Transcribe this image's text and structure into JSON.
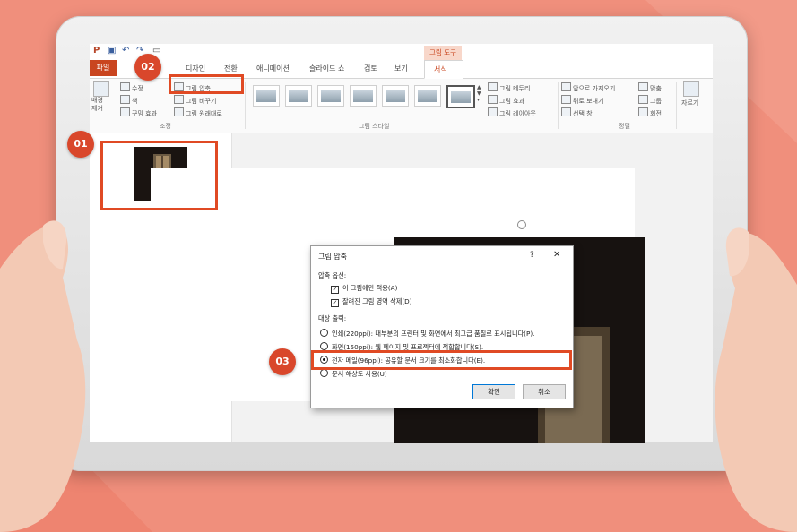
{
  "qat": {
    "icons": [
      "powerpoint-logo-icon",
      "save-icon",
      "undo-icon",
      "redo-icon",
      "presenter-icon"
    ]
  },
  "context_tab": {
    "header": "그림 도구"
  },
  "tabs": [
    {
      "label": "파일"
    },
    {
      "label": "디자인"
    },
    {
      "label": "전환"
    },
    {
      "label": "애니메이션"
    },
    {
      "label": "슬라이드 쇼"
    },
    {
      "label": "검토"
    },
    {
      "label": "보기"
    },
    {
      "label": "서식"
    }
  ],
  "ribbon": {
    "remove_bg": "배경\n제거",
    "corrections": "수정",
    "color": "색",
    "artistic": "꾸밈 효과",
    "compress": "그림 압축",
    "change": "그림 바꾸기",
    "reset": "그림 원래대로",
    "adjust_group": "조정",
    "styles_group": "그림 스타일",
    "border": "그림 테두리",
    "effects": "그림 효과",
    "layout": "그림 레이아웃",
    "bring_forward": "앞으로 가져오기",
    "send_backward": "뒤로 보내기",
    "selection_pane": "선택 창",
    "align": "맞춤",
    "group": "그룹",
    "rotate": "회전",
    "arrange_group": "정렬",
    "crop": "자르기"
  },
  "dialog": {
    "title": "그림 압축",
    "help": "?",
    "close": "✕",
    "options_heading": "압축 옵션:",
    "opt1": "이 그림에만 적용(A)",
    "opt2": "잘려진 그림 영역 삭제(D)",
    "target_heading": "대상 출력:",
    "r1": "인쇄(220ppi): 대부분의 프린터 및 화면에서 최고급 품질로 표시됩니다(P).",
    "r2": "화면(150ppi): 웹 페이지 및 프로젝터에 적합합니다(S).",
    "r3": "전자 메일(96ppi): 공유할 문서 크기를 최소화합니다(E).",
    "r4": "문서 해상도 사용(U)",
    "ok": "확인",
    "cancel": "취소",
    "selected_option": "전자 메일(96ppi)"
  },
  "callouts": {
    "c1": "01",
    "c2": "02",
    "c3": "03"
  },
  "colors": {
    "accent": "#d9472b",
    "background": "#f08f7c",
    "powerpoint": "#c9451f"
  }
}
